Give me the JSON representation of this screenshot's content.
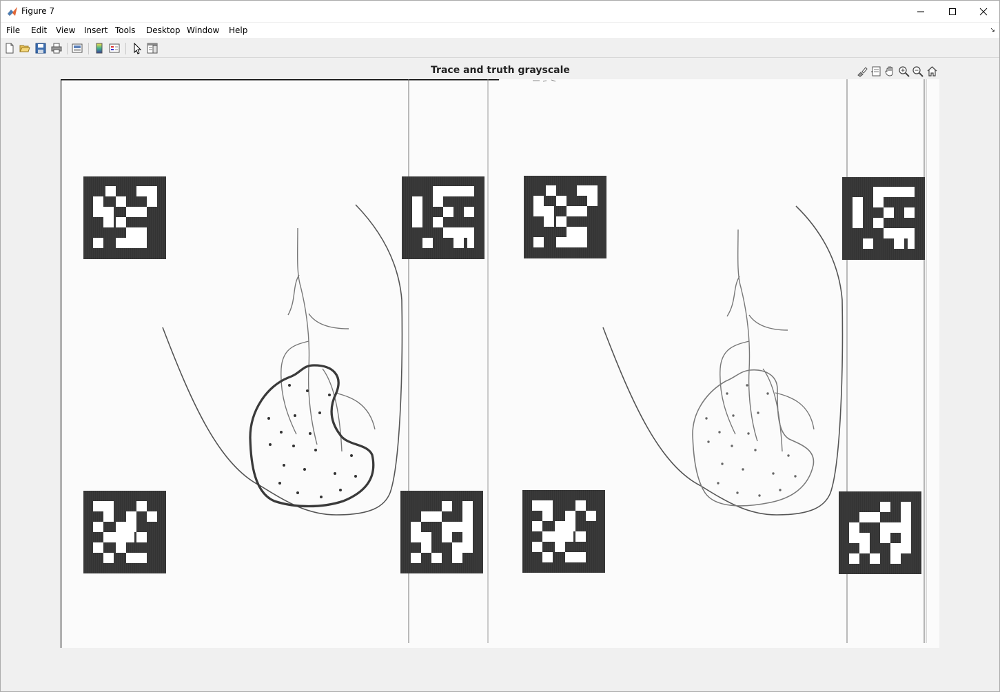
{
  "window": {
    "title": "Figure 7"
  },
  "menu": {
    "items": [
      "File",
      "Edit",
      "View",
      "Insert",
      "Tools",
      "Desktop",
      "Window",
      "Help"
    ]
  },
  "toolbar": {
    "icons": [
      "new-figure-icon",
      "open-file-icon",
      "save-icon",
      "print-icon",
      "print-preview-icon",
      "colorbar-icon",
      "legend-icon",
      "edit-plot-icon",
      "property-inspector-icon"
    ]
  },
  "axes": {
    "title": "Trace and truth grayscale",
    "tools": [
      "brush-icon",
      "data-tip-icon",
      "pan-icon",
      "zoom-in-icon",
      "zoom-out-icon",
      "home-icon"
    ]
  },
  "colors": {
    "background": "#f0f0f0",
    "paper": "#fbfbfb",
    "marker": "#3a3a3a",
    "pencil": "#6e6e6e"
  }
}
